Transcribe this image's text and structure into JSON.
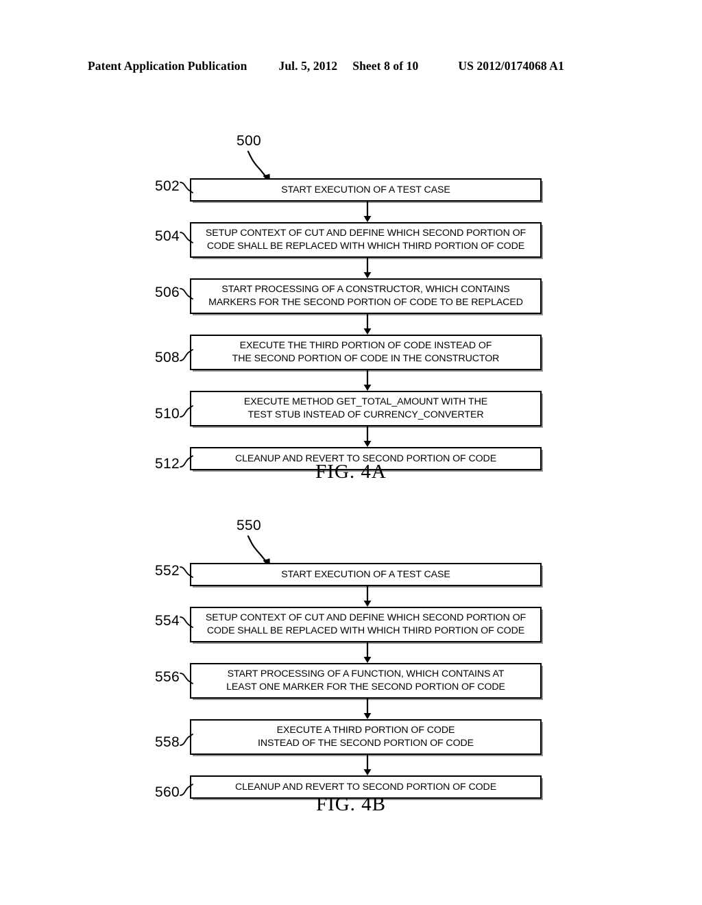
{
  "header": {
    "publication": "Patent Application Publication",
    "date": "Jul. 5, 2012",
    "sheet": "Sheet 8 of 10",
    "patent_number": "US 2012/0174068 A1"
  },
  "figures": [
    {
      "id": "fig-4a",
      "caption": "FIG. 4A",
      "reference_numeral": "500",
      "steps": [
        {
          "numeral": "502",
          "text": "START EXECUTION OF A TEST CASE",
          "lines": 1
        },
        {
          "numeral": "504",
          "text": "SETUP CONTEXT OF CUT AND DEFINE WHICH SECOND PORTION OF\nCODE SHALL BE REPLACED WITH WHICH THIRD PORTION OF CODE",
          "lines": 2
        },
        {
          "numeral": "506",
          "text": "START PROCESSING OF A CONSTRUCTOR, WHICH CONTAINS\nMARKERS FOR THE SECOND PORTION OF CODE TO BE REPLACED",
          "lines": 2
        },
        {
          "numeral": "508",
          "text": "EXECUTE THE THIRD PORTION OF CODE INSTEAD OF\nTHE SECOND PORTION OF CODE IN THE CONSTRUCTOR",
          "lines": 2
        },
        {
          "numeral": "510",
          "text": "EXECUTE METHOD GET_TOTAL_AMOUNT WITH THE\nTEST STUB INSTEAD OF CURRENCY_CONVERTER",
          "lines": 2
        },
        {
          "numeral": "512",
          "text": "CLEANUP AND REVERT TO SECOND PORTION OF CODE",
          "lines": 1
        }
      ]
    },
    {
      "id": "fig-4b",
      "caption": "FIG. 4B",
      "reference_numeral": "550",
      "steps": [
        {
          "numeral": "552",
          "text": "START EXECUTION OF A TEST CASE",
          "lines": 1
        },
        {
          "numeral": "554",
          "text": "SETUP CONTEXT OF CUT AND DEFINE WHICH SECOND PORTION OF\nCODE SHALL BE REPLACED WITH WHICH THIRD PORTION OF CODE",
          "lines": 2
        },
        {
          "numeral": "556",
          "text": "START PROCESSING OF A FUNCTION, WHICH CONTAINS AT\nLEAST ONE MARKER FOR THE SECOND PORTION OF CODE",
          "lines": 2
        },
        {
          "numeral": "558",
          "text": "EXECUTE A THIRD PORTION OF CODE\nINSTEAD OF THE SECOND PORTION OF CODE",
          "lines": 2
        },
        {
          "numeral": "560",
          "text": "CLEANUP AND REVERT TO SECOND PORTION OF CODE",
          "lines": 1
        }
      ]
    }
  ],
  "colors": {
    "ink": "#000000",
    "paper": "#ffffff"
  }
}
